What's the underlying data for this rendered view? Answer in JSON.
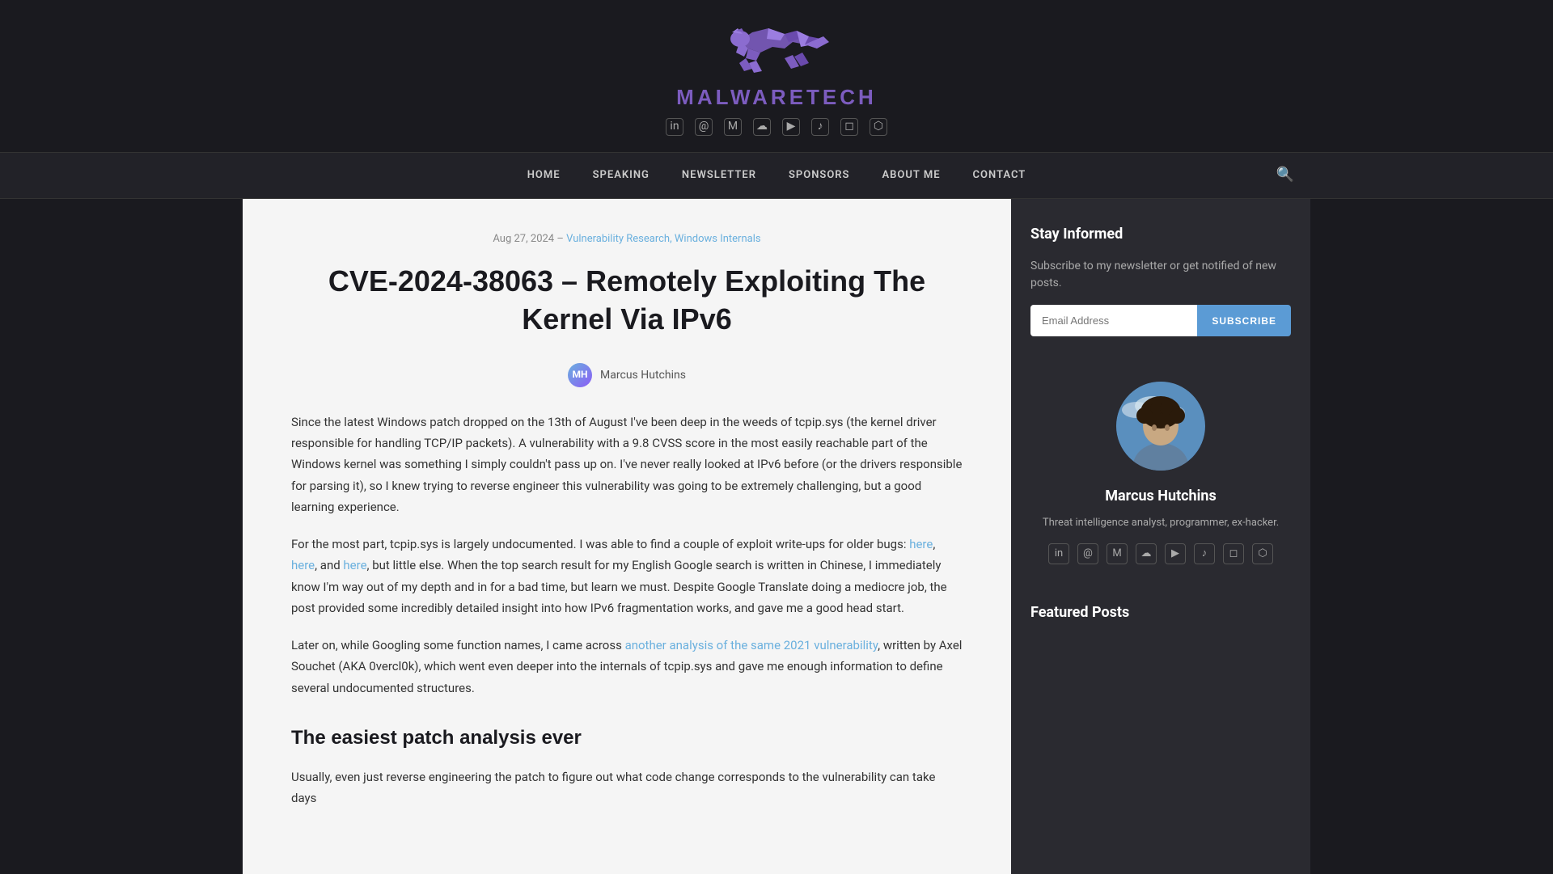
{
  "site": {
    "name": "MALWARETECH",
    "name_colored": "MALWARE",
    "name_plain": "TECH"
  },
  "header": {
    "social_icons": [
      {
        "name": "linkedin-icon",
        "symbol": "in",
        "label": "LinkedIn"
      },
      {
        "name": "email-icon",
        "symbol": "@",
        "label": "Email"
      },
      {
        "name": "mastodon-icon",
        "symbol": "M",
        "label": "Mastodon"
      },
      {
        "name": "blog-icon",
        "symbol": "☁",
        "label": "Blog"
      },
      {
        "name": "youtube-icon",
        "symbol": "▶",
        "label": "YouTube"
      },
      {
        "name": "tiktok-icon",
        "symbol": "♪",
        "label": "TikTok"
      },
      {
        "name": "instagram-icon",
        "symbol": "◻",
        "label": "Instagram"
      },
      {
        "name": "twitch-icon",
        "symbol": "⬡",
        "label": "Twitch"
      }
    ]
  },
  "nav": {
    "items": [
      {
        "label": "HOME",
        "name": "nav-home"
      },
      {
        "label": "SPEAKING",
        "name": "nav-speaking"
      },
      {
        "label": "NEWSLETTER",
        "name": "nav-newsletter"
      },
      {
        "label": "SPONSORS",
        "name": "nav-sponsors"
      },
      {
        "label": "ABOUT ME",
        "name": "nav-about"
      },
      {
        "label": "CONTACT",
        "name": "nav-contact"
      }
    ]
  },
  "post": {
    "date": "Aug 27, 2024",
    "separator": "–",
    "categories": "Vulnerability Research, Windows Internals",
    "title": "CVE-2024-38063 – Remotely Exploiting The Kernel Via IPv6",
    "author": "Marcus Hutchins",
    "body_paragraphs": [
      "Since the latest Windows patch dropped on the 13th of August I've been deep in the weeds of tcpip.sys (the kernel driver responsible for handling TCP/IP packets). A vulnerability with a 9.8 CVSS score in the most easily reachable part of the Windows kernel was something I simply couldn't pass up on. I've never really looked at IPv6 before (or the drivers responsible for parsing it), so I knew trying to reverse engineer this vulnerability was going to be extremely challenging, but a good learning experience.",
      "For the most part, tcpip.sys is largely undocumented. I was able to find a couple of exploit write-ups for older bugs: here, here, and here, but little else. When the top search result for my English Google search is written in Chinese, I immediately know I'm way out of my depth and in for a bad time, but learn we must. Despite Google Translate doing a mediocre job, the post provided some incredibly detailed insight into how IPv6 fragmentation works, and gave me a good head start.",
      "Later on, while Googling some function names, I came across another analysis of the same 2021 vulnerability, written by Axel Souchet (AKA 0vercl0k), which went even deeper into the internals of tcpip.sys and gave me enough information to define several undocumented structures."
    ],
    "section_heading": "The easiest patch analysis ever",
    "section_paragraph": "Usually, even just reverse engineering the patch to figure out what code change corresponds to the vulnerability can take days",
    "links": [
      {
        "text": "here",
        "id": "link1"
      },
      {
        "text": "here",
        "id": "link2"
      },
      {
        "text": "here",
        "id": "link3"
      },
      {
        "text": "another analysis of the same 2021 vulnerability",
        "id": "link4"
      }
    ]
  },
  "sidebar": {
    "newsletter": {
      "title": "Stay Informed",
      "description": "Subscribe to my newsletter or get notified of new posts.",
      "email_placeholder": "Email Address",
      "subscribe_label": "SUBSCRIBE"
    },
    "author": {
      "name": "Marcus Hutchins",
      "description": "Threat intelligence analyst, programmer, ex-hacker.",
      "social_icons": [
        {
          "name": "linkedin-icon",
          "symbol": "in",
          "label": "LinkedIn"
        },
        {
          "name": "email-icon",
          "symbol": "@",
          "label": "Email"
        },
        {
          "name": "mastodon-icon",
          "symbol": "M",
          "label": "Mastodon"
        },
        {
          "name": "blog-icon",
          "symbol": "☁",
          "label": "Blog"
        },
        {
          "name": "youtube-icon",
          "symbol": "▶",
          "label": "YouTube"
        },
        {
          "name": "tiktok-icon",
          "symbol": "♪",
          "label": "TikTok"
        },
        {
          "name": "instagram-icon",
          "symbol": "◻",
          "label": "Instagram"
        },
        {
          "name": "twitch-icon",
          "symbol": "⬡",
          "label": "Twitch"
        }
      ]
    },
    "featured_posts": {
      "title": "Featured Posts"
    }
  }
}
